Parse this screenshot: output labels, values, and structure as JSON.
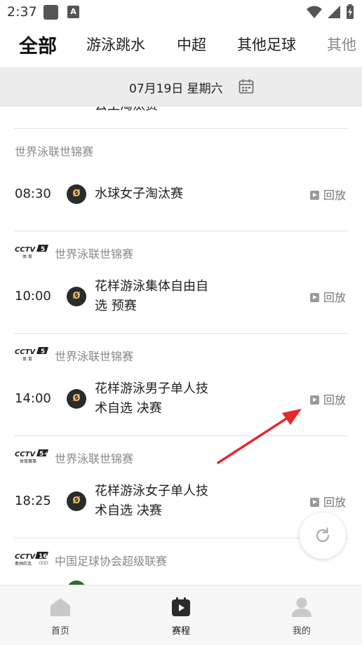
{
  "status_bar": {
    "time": "2:37",
    "notification_badge": "A"
  },
  "tabs": [
    {
      "label": "全部",
      "active": true
    },
    {
      "label": "游泳跳水",
      "active": false
    },
    {
      "label": "中超",
      "active": false
    },
    {
      "label": "其他足球",
      "active": false
    },
    {
      "label": "其他",
      "active": false
    }
  ],
  "date_bar": {
    "date": "07月19日  星期六"
  },
  "list": {
    "partial_top_text": "去主淘汰赛",
    "matches": [
      {
        "channel": "",
        "competition": "世界泳联世锦赛",
        "time": "08:30",
        "title_line1": "水球女子淘汰赛",
        "title_line2": "",
        "replay": "回放"
      },
      {
        "channel": "CCTV-5 体育",
        "competition": "世界泳联世锦赛",
        "time": "10:00",
        "title_line1": "花样游泳集体自由自",
        "title_line2": "选 预赛",
        "replay": "回放"
      },
      {
        "channel": "CCTV-5 体育",
        "competition": "世界泳联世锦赛",
        "time": "14:00",
        "title_line1": "花样游泳男子单人技",
        "title_line2": "术自选 决赛",
        "replay": "回放"
      },
      {
        "channel": "CCTV-5+ 体育赛事",
        "competition": "世界泳联世锦赛",
        "time": "18:25",
        "title_line1": "花样游泳女子单人技",
        "title_line2": "术自选 决赛",
        "replay": "回放"
      },
      {
        "channel": "CCTV-16 奥林匹克",
        "competition": "中国足球协会超级联赛",
        "time": "",
        "title_line1": "",
        "title_line2": "",
        "replay": ""
      }
    ]
  },
  "bottom_nav": [
    {
      "label": "首页",
      "icon": "home-icon",
      "active": false
    },
    {
      "label": "赛程",
      "icon": "schedule-icon",
      "active": true
    },
    {
      "label": "我的",
      "icon": "profile-icon",
      "active": false
    }
  ],
  "colors": {
    "arrow": "#e8262c",
    "active_tab": "#111111",
    "date_bar_bg": "#ececec",
    "team_icon_bg": "#2b2b2b"
  }
}
